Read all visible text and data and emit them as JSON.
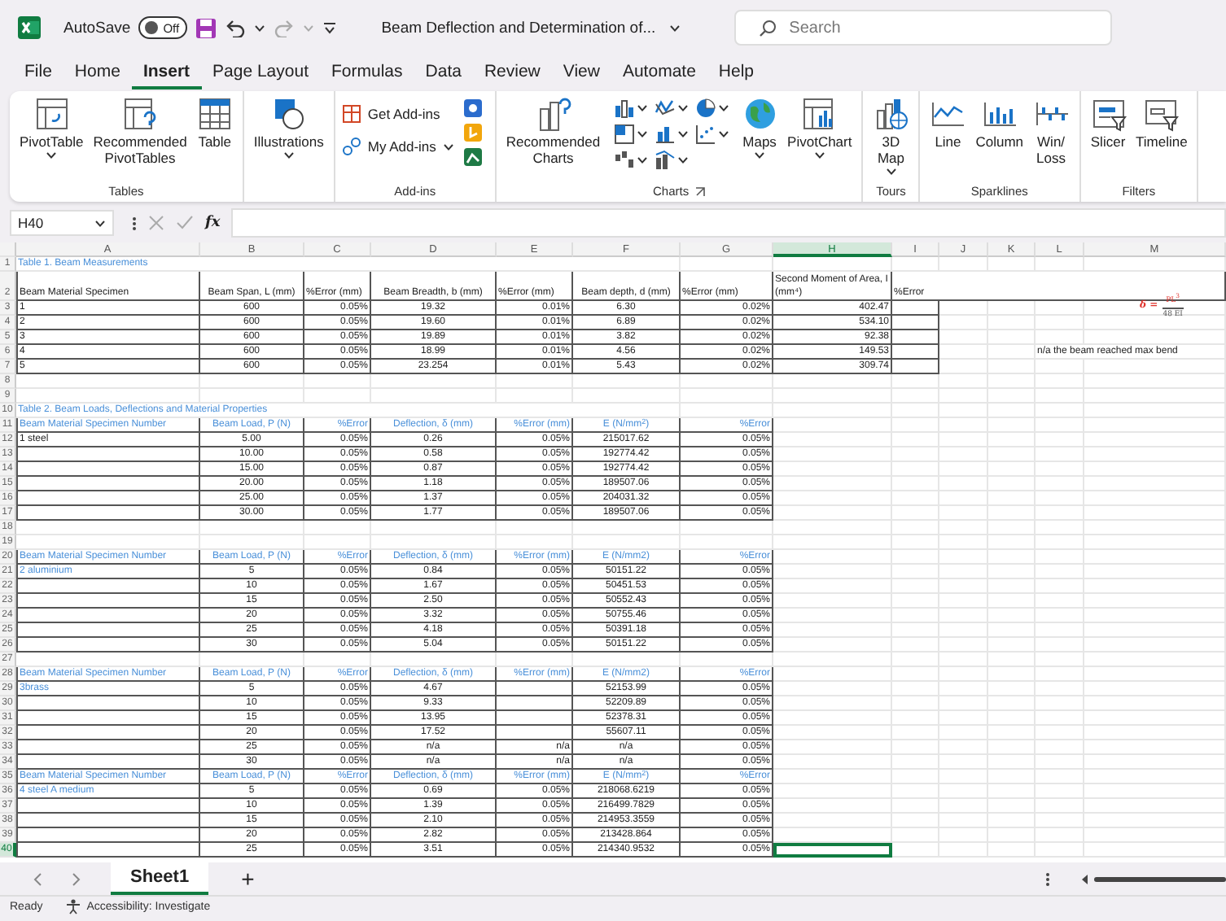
{
  "title_bar": {
    "autosave": {
      "label": "AutoSave",
      "on": false,
      "text": "Off"
    },
    "document_title": "Beam Deflection and Determination of...",
    "search": {
      "placeholder": "Search"
    }
  },
  "menu_tabs": [
    {
      "label": "File",
      "selected": false
    },
    {
      "label": "Home",
      "selected": false
    },
    {
      "label": "Insert",
      "selected": true
    },
    {
      "label": "Page Layout",
      "selected": false
    },
    {
      "label": "Formulas",
      "selected": false
    },
    {
      "label": "Data",
      "selected": false
    },
    {
      "label": "Review",
      "selected": false
    },
    {
      "label": "View",
      "selected": false
    },
    {
      "label": "Automate",
      "selected": false
    },
    {
      "label": "Help",
      "selected": false
    }
  ],
  "ribbon": [
    {
      "label": "Tables",
      "launcher": false,
      "buttons": [
        {
          "kind": "large",
          "label": "PivotTable",
          "dropdown": true
        },
        {
          "kind": "large",
          "label": "Recommended\nPivotTables",
          "dropdown": false
        },
        {
          "kind": "large",
          "label": "Table",
          "dropdown": false
        }
      ]
    },
    {
      "buttons": [
        {
          "kind": "large",
          "label": "Illustrations",
          "dropdown": true
        }
      ]
    },
    {
      "label": "Add-ins",
      "launcher": false,
      "buttons": [
        {
          "kind": "small",
          "label": "Get Add-ins",
          "dropdown": false
        },
        {
          "kind": "small",
          "label": "My Add-ins",
          "dropdown": true
        },
        {
          "kind": "apps"
        }
      ]
    },
    {
      "label": "Charts",
      "launcher": true,
      "buttons": [
        {
          "kind": "large",
          "label": "Recommended\nCharts",
          "dropdown": false
        },
        {
          "kind": "gallery"
        },
        {
          "kind": "large",
          "label": "Maps",
          "dropdown": true
        },
        {
          "kind": "large",
          "label": "PivotChart",
          "dropdown": true
        }
      ]
    },
    {
      "label": "Tours",
      "launcher": false,
      "buttons": [
        {
          "kind": "large",
          "label": "3D\nMap",
          "dropdown": true
        }
      ]
    },
    {
      "label": "Sparklines",
      "launcher": false,
      "buttons": [
        {
          "kind": "large",
          "label": "Line",
          "dropdown": false
        },
        {
          "kind": "large",
          "label": "Column",
          "dropdown": false
        },
        {
          "kind": "large",
          "label": "Win/\nLoss",
          "dropdown": false
        }
      ]
    },
    {
      "label": "Filters",
      "launcher": false,
      "buttons": [
        {
          "kind": "large",
          "label": "Slicer",
          "dropdown": false
        },
        {
          "kind": "large",
          "label": "Timeline",
          "dropdown": false
        }
      ]
    }
  ],
  "formula_bar": {
    "name_box": "H40",
    "function_label": "fx"
  },
  "sheet": {
    "columns": [
      {
        "label": "A",
        "selected": false
      },
      {
        "label": "B",
        "selected": false
      },
      {
        "label": "C",
        "selected": false
      },
      {
        "label": "D",
        "selected": false
      },
      {
        "label": "E",
        "selected": false
      },
      {
        "label": "F",
        "selected": false
      },
      {
        "label": "G",
        "selected": false
      },
      {
        "label": "H",
        "selected": true
      },
      {
        "label": "I",
        "selected": false
      },
      {
        "label": "J",
        "selected": false
      },
      {
        "label": "K",
        "selected": false
      },
      {
        "label": "L",
        "selected": false
      },
      {
        "label": "M",
        "selected": false
      }
    ],
    "equation": {
      "lhs": "δ =",
      "numerator": "PL$^{3}$",
      "denominator": "48 EI"
    },
    "rows": [
      {
        "n": "1",
        "kind": "title",
        "selected": false,
        "cells": {
          "A": "Table 1. Beam Measurements"
        }
      },
      {
        "n": "2",
        "kind": "colhead",
        "selected": false,
        "cells": {
          "A": "Beam Material Specimen",
          "B": "Beam Span, L (mm)",
          "C": "%Error (mm)",
          "D": "Beam Breadth, b (mm)",
          "E": "%Error (mm)",
          "F": "Beam depth, d (mm)",
          "G": "%Error (mm)",
          "H": "Second Moment of Area, I (mm⁴)",
          "I": "%Error"
        }
      },
      {
        "n": "3",
        "kind": "data1",
        "selected": false,
        "cells": {
          "A": "1",
          "B": "600",
          "C": "0.05%",
          "D": "19.32",
          "E": "0.01%",
          "F": "6.30",
          "G": "0.02%",
          "H": "402.47"
        }
      },
      {
        "n": "4",
        "kind": "data1",
        "selected": false,
        "cells": {
          "A": "2",
          "B": "600",
          "C": "0.05%",
          "D": "19.60",
          "E": "0.01%",
          "F": "6.89",
          "G": "0.02%",
          "H": "534.10"
        }
      },
      {
        "n": "5",
        "kind": "data1",
        "selected": false,
        "cells": {
          "A": "3",
          "B": "600",
          "C": "0.05%",
          "D": "19.89",
          "E": "0.01%",
          "F": "3.82",
          "G": "0.02%",
          "H": "92.38"
        }
      },
      {
        "n": "6",
        "kind": "data1",
        "selected": false,
        "cells": {
          "A": "4",
          "B": "600",
          "C": "0.05%",
          "D": "18.99",
          "E": "0.01%",
          "F": "4.56",
          "G": "0.02%",
          "H": "149.53",
          "L": "n/a the beam reached max bend"
        }
      },
      {
        "n": "7",
        "kind": "data1",
        "selected": false,
        "cells": {
          "A": "5",
          "B": "600",
          "C": "0.05%",
          "D": "23.254",
          "E": "0.01%",
          "F": "5.43",
          "G": "0.02%",
          "H": "309.74"
        }
      },
      {
        "n": "8",
        "kind": "blank",
        "selected": false,
        "cells": {}
      },
      {
        "n": "9",
        "kind": "blank",
        "selected": false,
        "cells": {}
      },
      {
        "n": "10",
        "kind": "title",
        "selected": false,
        "cells": {
          "A": "Table 2. Beam Loads, Deflections and Material Properties"
        }
      },
      {
        "n": "11",
        "kind": "header",
        "selected": false,
        "cells": {
          "A": "Beam Material Specimen Number",
          "B": "Beam Load, P (N)",
          "C": "%Error",
          "D": "Deflection, δ (mm)",
          "E": "%Error (mm)",
          "F": "E (N/mm$^{2}$)",
          "G": "%Error"
        }
      },
      {
        "n": "12",
        "kind": "data",
        "selected": false,
        "cells": {
          "A": "1 steel",
          "B": "5.00",
          "C": "0.05%",
          "D": "0.26",
          "E": "0.05%",
          "F": "215017.62",
          "G": "0.05%"
        }
      },
      {
        "n": "13",
        "kind": "data",
        "selected": false,
        "cells": {
          "B": "10.00",
          "C": "0.05%",
          "D": "0.58",
          "E": "0.05%",
          "F": "192774.42",
          "G": "0.05%"
        }
      },
      {
        "n": "14",
        "kind": "data",
        "selected": false,
        "cells": {
          "B": "15.00",
          "C": "0.05%",
          "D": "0.87",
          "E": "0.05%",
          "F": "192774.42",
          "G": "0.05%"
        }
      },
      {
        "n": "15",
        "kind": "data",
        "selected": false,
        "cells": {
          "B": "20.00",
          "C": "0.05%",
          "D": "1.18",
          "E": "0.05%",
          "F": "189507.06",
          "G": "0.05%"
        }
      },
      {
        "n": "16",
        "kind": "data",
        "selected": false,
        "cells": {
          "B": "25.00",
          "C": "0.05%",
          "D": "1.37",
          "E": "0.05%",
          "F": "204031.32",
          "G": "0.05%"
        }
      },
      {
        "n": "17",
        "kind": "data",
        "selected": false,
        "cells": {
          "B": "30.00",
          "C": "0.05%",
          "D": "1.77",
          "E": "0.05%",
          "F": "189507.06",
          "G": "0.05%"
        }
      },
      {
        "n": "18",
        "kind": "blank",
        "selected": false,
        "cells": {}
      },
      {
        "n": "19",
        "kind": "blank",
        "selected": false,
        "cells": {}
      },
      {
        "n": "20",
        "kind": "header",
        "selected": false,
        "cells": {
          "A": "Beam Material Specimen Number",
          "B": "Beam Load, P (N)",
          "C": "%Error",
          "D": "Deflection, δ (mm)",
          "E": "%Error (mm)",
          "F": "E (N/mm2)",
          "G": "%Error"
        }
      },
      {
        "n": "21",
        "kind": "specimen",
        "selected": false,
        "cells": {
          "A": "2 aluminium",
          "B": "5",
          "C": "0.05%",
          "D": "0.84",
          "E": "0.05%",
          "F": "50151.22",
          "G": "0.05%"
        }
      },
      {
        "n": "22",
        "kind": "data",
        "selected": false,
        "cells": {
          "B": "10",
          "C": "0.05%",
          "D": "1.67",
          "E": "0.05%",
          "F": "50451.53",
          "G": "0.05%"
        }
      },
      {
        "n": "23",
        "kind": "data",
        "selected": false,
        "cells": {
          "B": "15",
          "C": "0.05%",
          "D": "2.50",
          "E": "0.05%",
          "F": "50552.43",
          "G": "0.05%"
        }
      },
      {
        "n": "24",
        "kind": "data",
        "selected": false,
        "cells": {
          "B": "20",
          "C": "0.05%",
          "D": "3.32",
          "E": "0.05%",
          "F": "50755.46",
          "G": "0.05%"
        }
      },
      {
        "n": "25",
        "kind": "data",
        "selected": false,
        "cells": {
          "B": "25",
          "C": "0.05%",
          "D": "4.18",
          "E": "0.05%",
          "F": "50391.18",
          "G": "0.05%"
        }
      },
      {
        "n": "26",
        "kind": "data",
        "selected": false,
        "cells": {
          "B": "30",
          "C": "0.05%",
          "D": "5.04",
          "E": "0.05%",
          "F": "50151.22",
          "G": "0.05%"
        }
      },
      {
        "n": "27",
        "kind": "blank",
        "selected": false,
        "cells": {}
      },
      {
        "n": "28",
        "kind": "header",
        "selected": false,
        "cells": {
          "A": "Beam Material Specimen Number",
          "B": "Beam Load, P (N)",
          "C": "%Error",
          "D": "Deflection, δ (mm)",
          "E": "%Error (mm)",
          "F": "E (N/mm2)",
          "G": "%Error"
        }
      },
      {
        "n": "29",
        "kind": "specimen",
        "selected": false,
        "cells": {
          "A": "3brass",
          "B": "5",
          "C": "0.05%",
          "D": "4.67",
          "F": "52153.99",
          "G": "0.05%"
        }
      },
      {
        "n": "30",
        "kind": "data",
        "selected": false,
        "cells": {
          "B": "10",
          "C": "0.05%",
          "D": "9.33",
          "F": "52209.89",
          "G": "0.05%"
        }
      },
      {
        "n": "31",
        "kind": "data",
        "selected": false,
        "cells": {
          "B": "15",
          "C": "0.05%",
          "D": "13.95",
          "F": "52378.31",
          "G": "0.05%"
        }
      },
      {
        "n": "32",
        "kind": "data",
        "selected": false,
        "cells": {
          "B": "20",
          "C": "0.05%",
          "D": "17.52",
          "F": "55607.11",
          "G": "0.05%"
        }
      },
      {
        "n": "33",
        "kind": "data",
        "selected": false,
        "cells": {
          "B": "25",
          "C": "0.05%",
          "D": "n/a",
          "E": "n/a",
          "F": "n/a",
          "G": "0.05%"
        }
      },
      {
        "n": "34",
        "kind": "data",
        "selected": false,
        "cells": {
          "B": "30",
          "C": "0.05%",
          "D": "n/a",
          "E": "n/a",
          "F": "n/a",
          "G": "0.05%"
        }
      },
      {
        "n": "35",
        "kind": "header",
        "selected": false,
        "cells": {
          "A": "Beam Material Specimen Number",
          "B": "Beam Load, P (N)",
          "C": "%Error",
          "D": "Deflection, δ (mm)",
          "E": "%Error (mm)",
          "F": "E (N/mm$^{2}$)",
          "G": "%Error"
        }
      },
      {
        "n": "36",
        "kind": "specimen",
        "selected": false,
        "cells": {
          "A": "4 steel A medium",
          "B": "5",
          "C": "0.05%",
          "D": "0.69",
          "E": "0.05%",
          "F": "218068.6219",
          "G": "0.05%"
        }
      },
      {
        "n": "37",
        "kind": "data",
        "selected": false,
        "cells": {
          "B": "10",
          "C": "0.05%",
          "D": "1.39",
          "E": "0.05%",
          "F": "216499.7829",
          "G": "0.05%"
        }
      },
      {
        "n": "38",
        "kind": "data",
        "selected": false,
        "cells": {
          "B": "15",
          "C": "0.05%",
          "D": "2.10",
          "E": "0.05%",
          "F": "214953.3559",
          "G": "0.05%"
        }
      },
      {
        "n": "39",
        "kind": "data",
        "selected": false,
        "cells": {
          "B": "20",
          "C": "0.05%",
          "D": "2.82",
          "E": "0.05%",
          "F": "213428.864",
          "G": "0.05%"
        }
      },
      {
        "n": "40",
        "kind": "data",
        "selected": true,
        "cells": {
          "B": "25",
          "C": "0.05%",
          "D": "3.51",
          "E": "0.05%",
          "F": "214340.9532",
          "G": "0.05%"
        }
      }
    ]
  },
  "sheet_tabs": {
    "tabs": [
      {
        "label": "Sheet1",
        "selected": true
      }
    ],
    "add_label": "+"
  },
  "status_bar": {
    "ready": "Ready",
    "accessibility": "Accessibility: Investigate"
  }
}
